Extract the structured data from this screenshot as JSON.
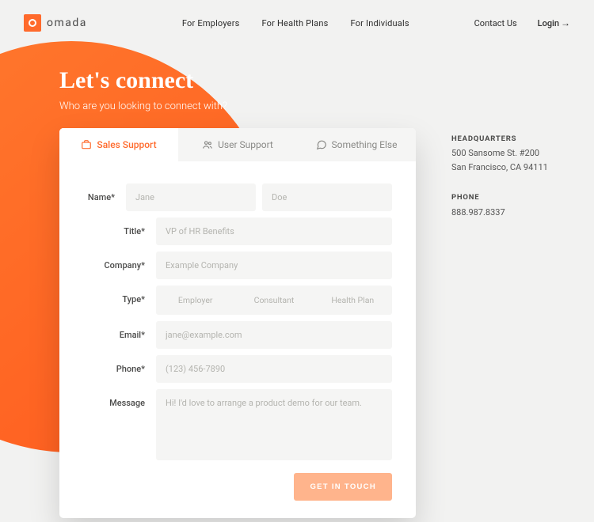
{
  "brand": {
    "name": "omada"
  },
  "nav": {
    "employers": "For Employers",
    "healthplans": "For Health Plans",
    "individuals": "For Individuals",
    "contact": "Contact Us",
    "login": "Login"
  },
  "hero": {
    "title": "Let's connect",
    "subtitle": "Who are you looking to connect with?"
  },
  "tabs": {
    "sales": "Sales Support",
    "user": "User Support",
    "other": "Something Else"
  },
  "form": {
    "labels": {
      "name": "Name*",
      "title": "Title*",
      "company": "Company*",
      "type": "Type*",
      "email": "Email*",
      "phone": "Phone*",
      "message": "Message"
    },
    "placeholders": {
      "firstname": "Jane",
      "lastname": "Doe",
      "title": "VP of HR Benefits",
      "company": "Example Company",
      "email": "jane@example.com",
      "phone": "(123) 456-7890",
      "message": "Hi! I'd love to arrange a product demo for our team."
    },
    "typeOptions": {
      "employer": "Employer",
      "consultant": "Consultant",
      "healthplan": "Health Plan"
    },
    "submit": "GET IN TOUCH"
  },
  "sidebar": {
    "hq_label": "HEADQUARTERS",
    "hq_line1": "500 Sansome St. #200",
    "hq_line2": "San Francisco, CA 94111",
    "phone_label": "PHONE",
    "phone_value": "888.987.8337"
  }
}
